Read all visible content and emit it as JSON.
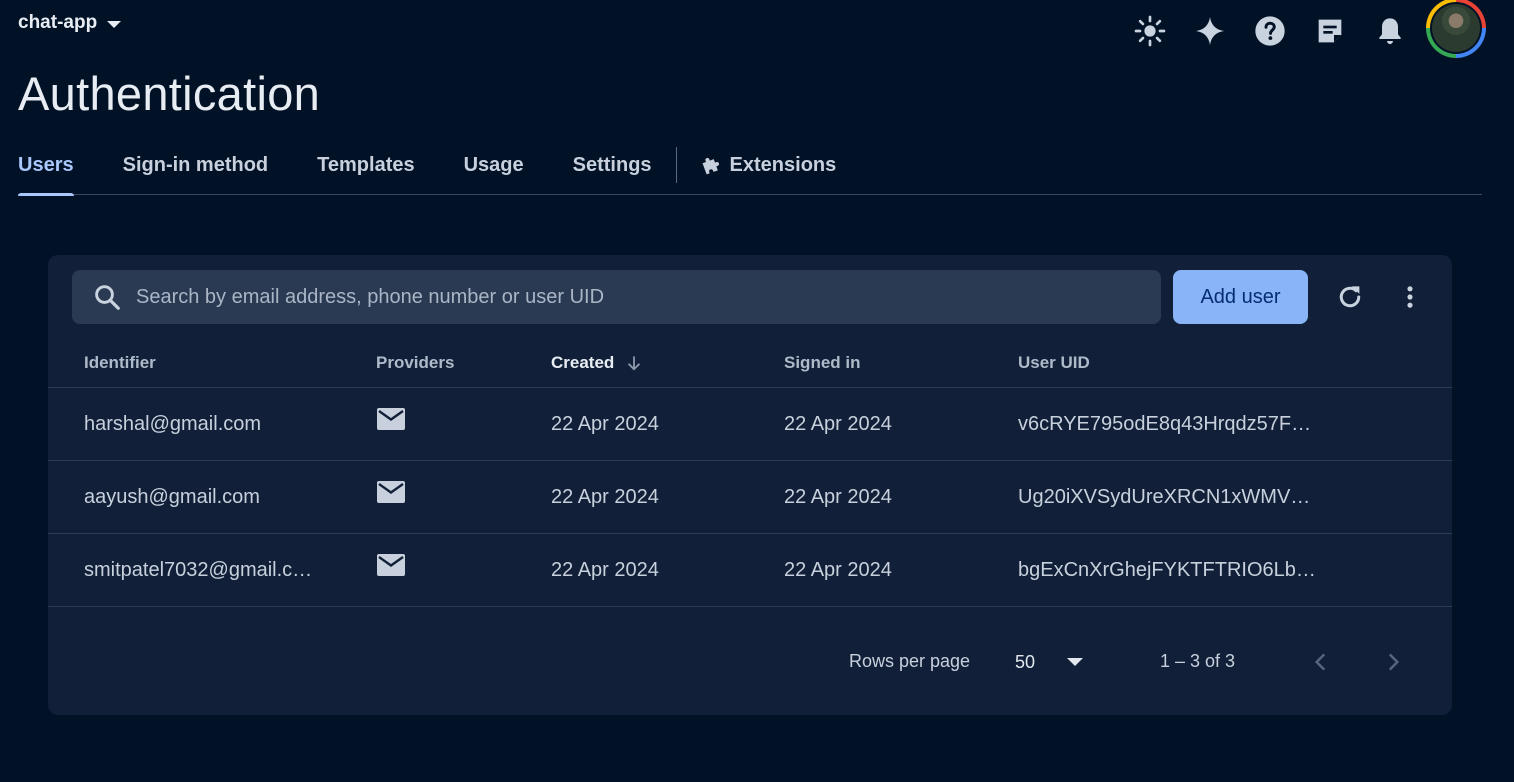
{
  "topbar": {
    "project_name": "chat-app",
    "icons": [
      "theme-sun-icon",
      "gemini-sparkle-icon",
      "help-icon",
      "release-notes-icon",
      "notifications-bell-icon"
    ]
  },
  "page": {
    "title": "Authentication"
  },
  "tabs": [
    {
      "label": "Users",
      "active": true
    },
    {
      "label": "Sign-in method"
    },
    {
      "label": "Templates"
    },
    {
      "label": "Usage"
    },
    {
      "label": "Settings"
    },
    {
      "label": "Extensions",
      "icon": "extension-puzzle-icon"
    }
  ],
  "toolbar": {
    "search_placeholder": "Search by email address, phone number or user UID",
    "search_value": "",
    "add_user_label": "Add user"
  },
  "table": {
    "columns": [
      "Identifier",
      "Providers",
      "Created",
      "Signed in",
      "User UID"
    ],
    "sorted_column": "Created",
    "sort_direction": "descending",
    "rows": [
      {
        "identifier": "harshal@gmail.com",
        "provider": "email-icon",
        "created": "22 Apr 2024",
        "signed_in": "22 Apr 2024",
        "uid": "v6cRYE795odE8q43Hrqdz57F…"
      },
      {
        "identifier": "aayush@gmail.com",
        "provider": "email-icon",
        "created": "22 Apr 2024",
        "signed_in": "22 Apr 2024",
        "uid": "Ug20iXVSydUreXRCN1xWMV…"
      },
      {
        "identifier": "smitpatel7032@gmail.c…",
        "provider": "email-icon",
        "created": "22 Apr 2024",
        "signed_in": "22 Apr 2024",
        "uid": "bgExCnXrGhejFYKTFTRIO6Lb…"
      }
    ]
  },
  "pagination": {
    "rows_per_page_label": "Rows per page",
    "rows_per_page_value": "50",
    "range_label": "1 – 3 of 3"
  },
  "colors": {
    "background": "#021226",
    "card": "#112038",
    "accent": "#a8c7fa",
    "primary_button": "#8ab4f8"
  }
}
